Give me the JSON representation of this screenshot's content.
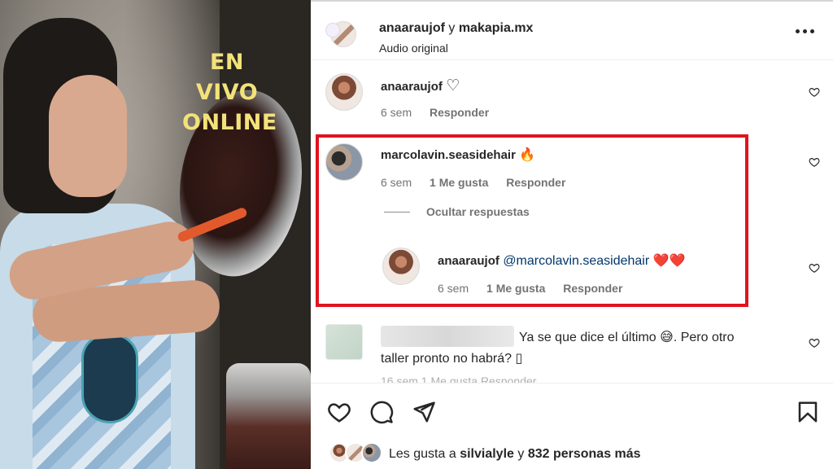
{
  "media": {
    "overlay_line1": "EN VIVO",
    "overlay_line2": "ONLINE"
  },
  "header": {
    "user1": "anaaraujof",
    "joiner": "y",
    "user2": "makapia.mx",
    "subtitle": "Audio original"
  },
  "comments": [
    {
      "username": "anaaraujof",
      "text": "♡",
      "time": "6 sem",
      "reply_label": "Responder"
    },
    {
      "username": "marcolavin.seasidehair",
      "text": "🔥",
      "time": "6 sem",
      "likes": "1 Me gusta",
      "reply_label": "Responder",
      "hide_replies_label": "Ocultar respuestas",
      "reply": {
        "username": "anaaraujof",
        "mention": "@marcolavin.seasidehair",
        "text": "❤️❤️",
        "time": "6 sem",
        "likes": "1 Me gusta",
        "reply_label": "Responder"
      }
    },
    {
      "username": "",
      "text_line1": "Ya se que dice el último 😅. Pero otro",
      "text_line2": "taller pronto no habrá? ▯",
      "time_partial": "16 sem  1 Me gusta  Responder"
    }
  ],
  "actions": {
    "icons": [
      "heart-icon",
      "comment-icon",
      "share-icon",
      "bookmark-icon"
    ]
  },
  "likes": {
    "prefix": "Les gusta a",
    "user": "silvialyle",
    "joiner": "y",
    "count_text": "832 personas más"
  },
  "colors": {
    "highlight": "#e0141f",
    "overlay_text": "#f3e27a",
    "mention": "#00376b"
  }
}
